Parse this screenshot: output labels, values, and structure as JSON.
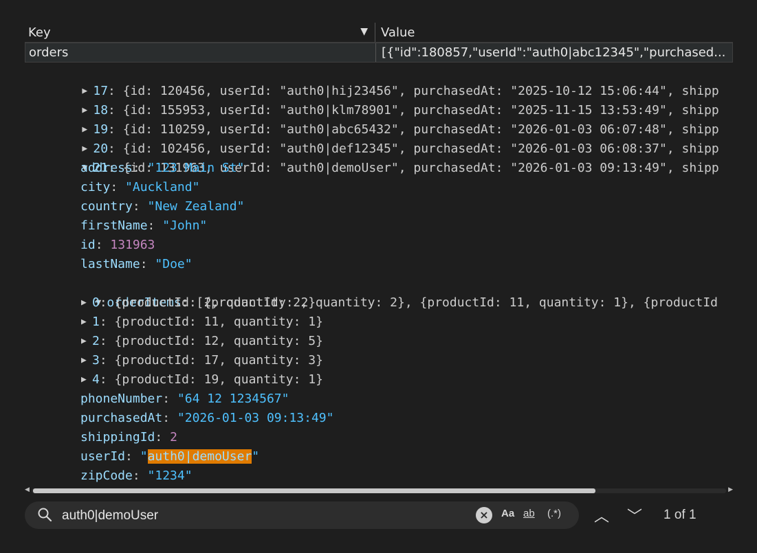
{
  "table": {
    "col_key": "Key",
    "col_value": "Value",
    "row": {
      "key": "orders",
      "value": "[{\"id\":180857,\"userId\":\"auth0|abc12345\",\"purchased..."
    }
  },
  "tree": {
    "collapsed_orders": [
      {
        "index": "17",
        "id": "120456",
        "userId": "\"auth0|hij23456\"",
        "purchasedAt": "\"2025-10-12 15:06:44\"",
        "tail": ", shipp"
      },
      {
        "index": "18",
        "id": "155953",
        "userId": "\"auth0|klm78901\"",
        "purchasedAt": "\"2025-11-15 13:53:49\"",
        "tail": ", shipp"
      },
      {
        "index": "19",
        "id": "110259",
        "userId": "\"auth0|abc65432\"",
        "purchasedAt": "\"2026-01-03 06:07:48\"",
        "tail": ", shipp"
      },
      {
        "index": "20",
        "id": "102456",
        "userId": "\"auth0|def12345\"",
        "purchasedAt": "\"2026-01-03 06:08:37\"",
        "tail": ", shipp"
      }
    ],
    "expanded_order": {
      "index": "21",
      "id": "131963",
      "userId": "\"auth0|demoUser\"",
      "purchasedAt": "\"2026-01-03 09:13:49\"",
      "tail": ", shipp"
    },
    "fields_top": [
      {
        "key": "address",
        "value": "\"123 Main St\"",
        "kind": "s"
      },
      {
        "key": "city",
        "value": "\"Auckland\"",
        "kind": "s"
      },
      {
        "key": "country",
        "value": "\"New Zealand\"",
        "kind": "s"
      },
      {
        "key": "firstName",
        "value": "\"John\"",
        "kind": "s"
      },
      {
        "key": "id",
        "value": "131963",
        "kind": "n"
      },
      {
        "key": "lastName",
        "value": "\"Doe\"",
        "kind": "s"
      }
    ],
    "order_items": {
      "key": "orderItems",
      "summary": "[{productId: 2, quantity: 2}, {productId: 11, quantity: 1}, {productId",
      "items": [
        {
          "index": "0",
          "value": "{productId: 2, quantity: 2}"
        },
        {
          "index": "1",
          "value": "{productId: 11, quantity: 1}"
        },
        {
          "index": "2",
          "value": "{productId: 12, quantity: 5}"
        },
        {
          "index": "3",
          "value": "{productId: 17, quantity: 3}"
        },
        {
          "index": "4",
          "value": "{productId: 19, quantity: 1}"
        }
      ]
    },
    "fields_bottom": [
      {
        "key": "phoneNumber",
        "value": "\"64 12 1234567\"",
        "kind": "s"
      },
      {
        "key": "purchasedAt",
        "value": "\"2026-01-03 09:13:49\"",
        "kind": "s"
      },
      {
        "key": "shippingId",
        "value": "2",
        "kind": "n"
      }
    ],
    "user_id": {
      "key": "userId",
      "quote_open": "\"",
      "match": "auth0|demoUser",
      "quote_close": "\""
    },
    "zip": {
      "key": "zipCode",
      "value": "\"1234\""
    }
  },
  "find": {
    "query": "auth0|demoUser",
    "case_label": "Aa",
    "word_label": "ab",
    "regex_label": "(.*)",
    "match_count": "1 of 1"
  },
  "icons": {
    "search": "search-icon",
    "clear": "clear-icon",
    "up": "chevron-up-icon",
    "down": "chevron-down-icon",
    "expand": "chevron-right-icon",
    "collapse": "chevron-down-icon",
    "sort": "sort-desc-icon"
  },
  "colors": {
    "key": "#9cdcfe",
    "string": "#4fc1ff",
    "number": "#c586c0",
    "highlight": "#e07b00"
  }
}
